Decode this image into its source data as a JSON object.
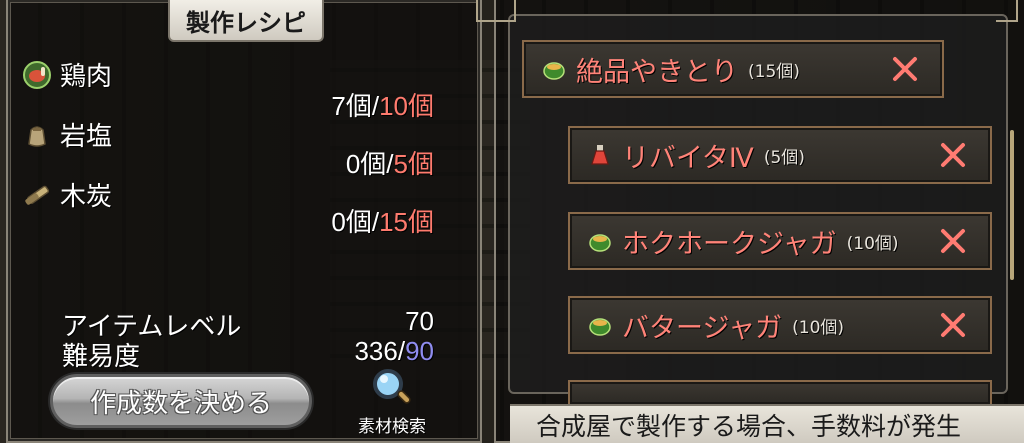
{
  "left_panel": {
    "title": "製作レシピ",
    "ingredients": [
      {
        "name": "鶏肉",
        "have": "7個",
        "sep": "/",
        "need": "10個",
        "icon": "meat-icon"
      },
      {
        "name": "岩塩",
        "have": "0個",
        "sep": "/",
        "need": "5個",
        "icon": "salt-bag-icon"
      },
      {
        "name": "木炭",
        "have": "0個",
        "sep": "/",
        "need": "15個",
        "icon": "charcoal-icon"
      }
    ],
    "item_level_label": "アイテムレベル",
    "item_level_value": "70",
    "difficulty_label": "難易度",
    "difficulty_value": "336",
    "difficulty_sep": "/",
    "difficulty_max": "90",
    "decide_button": "作成数を決める",
    "search_button": "素材検索"
  },
  "right_panel": {
    "recipes": [
      {
        "name": "絶品やきとり",
        "qty": "(15個)",
        "icon": "food-pot-icon"
      },
      {
        "name": "リバイタⅣ",
        "qty": "(5個)",
        "icon": "potion-icon"
      },
      {
        "name": "ホクホークジャガ",
        "qty": "(10個)",
        "icon": "food-pot-icon"
      },
      {
        "name": "バタージャガ",
        "qty": "(10個)",
        "icon": "food-pot-icon"
      }
    ],
    "footer": "合成屋で製作する場合、手数料が発生"
  },
  "colors": {
    "need_red": "#ff7b6e",
    "difficulty_max_blue": "#8f8cf0",
    "recipe_name_red": "#ff8378",
    "remove_x": "#ff7b72"
  }
}
